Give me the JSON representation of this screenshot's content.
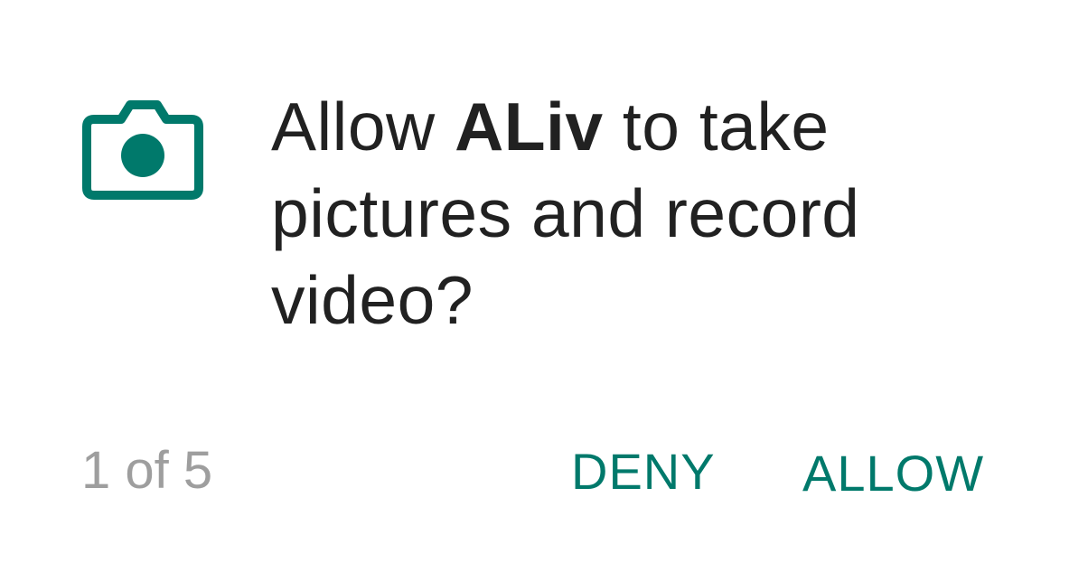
{
  "dialog": {
    "icon": "camera-icon",
    "message_prefix": "Allow ",
    "app_name": "ALiv",
    "message_suffix": " to take pictures and record video?",
    "counter": "1 of 5",
    "deny_label": "DENY",
    "allow_label": "ALLOW"
  },
  "colors": {
    "accent": "#00796B",
    "text_primary": "#212121",
    "text_secondary": "#9E9E9E",
    "background": "#FFFFFF"
  }
}
